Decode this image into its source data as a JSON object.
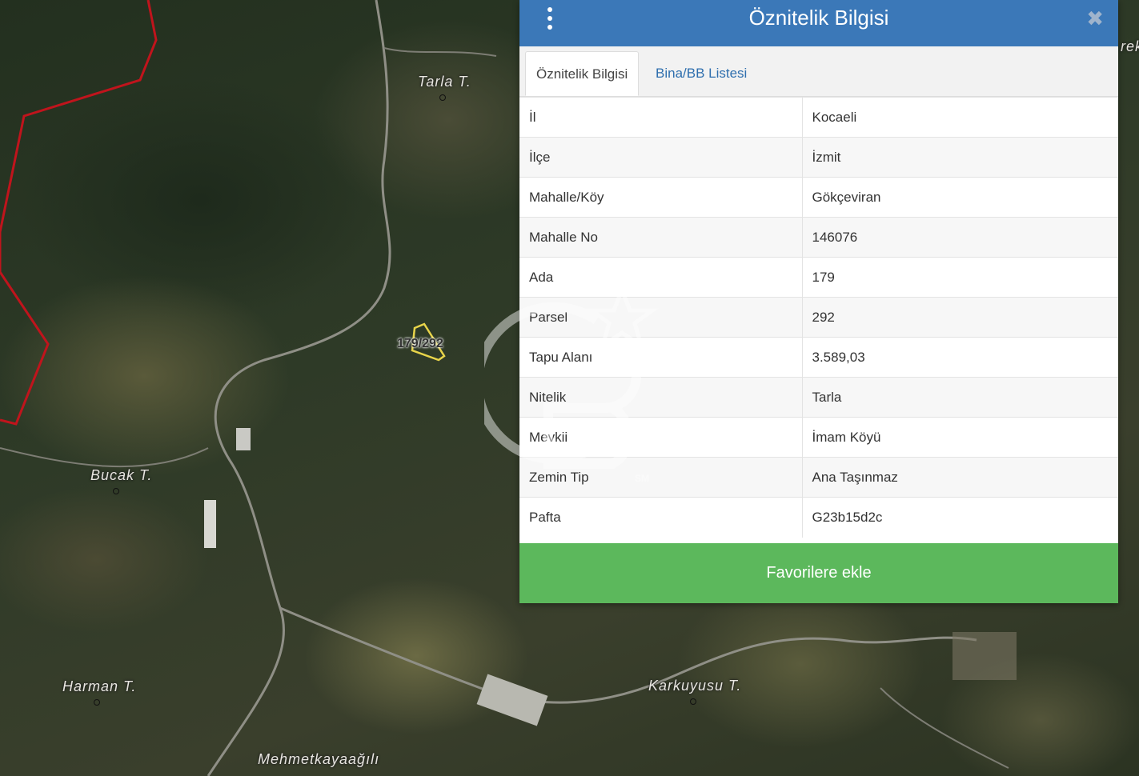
{
  "map": {
    "places": [
      {
        "id": "tarla",
        "name": "Tarla T."
      },
      {
        "id": "bucak",
        "name": "Bucak T."
      },
      {
        "id": "harman",
        "name": "Harman T."
      },
      {
        "id": "karkuyusu",
        "name": "Karkuyusu T."
      },
      {
        "id": "mehmetkaya",
        "name": "Mehmetkayaağılı"
      },
      {
        "id": "edge",
        "name": "rek"
      }
    ],
    "parcel_label": "179/292"
  },
  "panel": {
    "title": "Öznitelik Bilgisi",
    "close_label": "✖",
    "tabs": [
      {
        "label": "Öznitelik Bilgisi",
        "active": true
      },
      {
        "label": "Bina/BB Listesi",
        "active": false
      }
    ],
    "rows": [
      {
        "key": "İl",
        "value": "Kocaeli"
      },
      {
        "key": "İlçe",
        "value": "İzmit"
      },
      {
        "key": "Mahalle/Köy",
        "value": "Gökçeviran"
      },
      {
        "key": "Mahalle No",
        "value": "146076"
      },
      {
        "key": "Ada",
        "value": "179"
      },
      {
        "key": "Parsel",
        "value": "292"
      },
      {
        "key": "Tapu Alanı",
        "value": "3.589,03"
      },
      {
        "key": "Nitelik",
        "value": "Tarla"
      },
      {
        "key": "Mevkii",
        "value": "İmam Köyü"
      },
      {
        "key": "Zemin Tip",
        "value": "Ana Taşınmaz"
      },
      {
        "key": "Pafta",
        "value": "G23b15d2c"
      }
    ],
    "favorite_button": "Favorilere ekle"
  },
  "watermark": {
    "text": "SM"
  },
  "colors": {
    "header": "#3b78b8",
    "tab_link": "#2f6fae",
    "button": "#5cb85c",
    "boundary": "#c0141c",
    "parcel": "#e8d44a"
  }
}
